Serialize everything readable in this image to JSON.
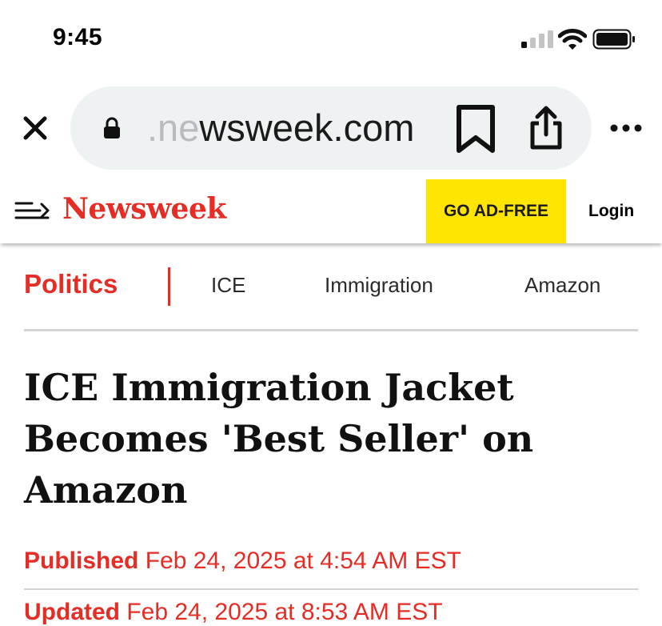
{
  "status_bar": {
    "time": "9:45"
  },
  "browser": {
    "url_faded": ".ne",
    "url_main": "wsweek.com"
  },
  "site": {
    "logo": "Newsweek",
    "ad_free_label": "GO AD-FREE",
    "login_label": "Login"
  },
  "topics": {
    "main": "Politics",
    "items": [
      "ICE",
      "Immigration",
      "Amazon"
    ]
  },
  "article": {
    "headline": "ICE Immigration Jacket Becomes 'Best Seller' on Amazon",
    "published_label": "Published",
    "published_date": "Feb 24, 2025 at 4:54 AM EST",
    "updated_label": "Updated",
    "updated_date": "Feb 24, 2025 at 8:53 AM EST"
  },
  "colors": {
    "brand_red": "#e52d26",
    "ad_yellow": "#ffe500"
  }
}
